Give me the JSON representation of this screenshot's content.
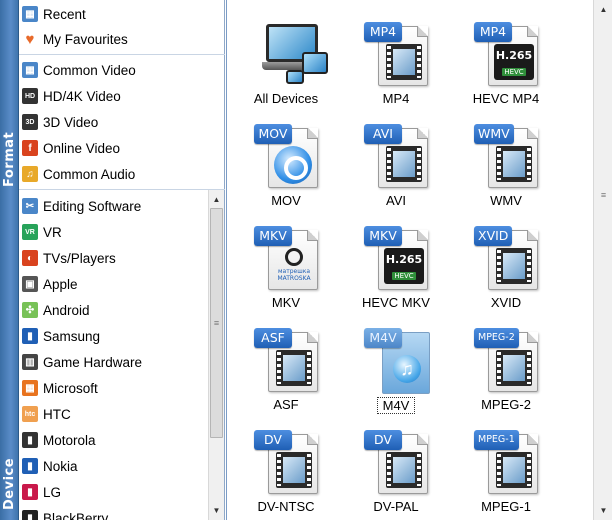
{
  "tabs": {
    "format_label": "Format",
    "device_label": "Device"
  },
  "format_list": [
    {
      "label": "Recent",
      "icon": "recent-icon",
      "color": "#4a86c8"
    },
    {
      "label": "My Favourites",
      "icon": "heart-icon",
      "color": "#e86a2a"
    },
    {
      "label": "Common Video",
      "icon": "film-icon",
      "color": "#4a86c8"
    },
    {
      "label": "HD/4K Video",
      "icon": "hd-icon",
      "color": "#333333"
    },
    {
      "label": "3D Video",
      "icon": "3d-icon",
      "color": "#333333"
    },
    {
      "label": "Online Video",
      "icon": "online-video-icon",
      "color": "#d9431e"
    },
    {
      "label": "Common Audio",
      "icon": "music-note-icon",
      "color": "#e8a92a"
    }
  ],
  "device_list": [
    {
      "label": "Editing Software",
      "icon": "editing-software-icon",
      "color": "#4a86c8"
    },
    {
      "label": "VR",
      "icon": "vr-icon",
      "color": "#27a35a"
    },
    {
      "label": "TVs/Players",
      "icon": "tv-icon",
      "color": "#d9431e"
    },
    {
      "label": "Apple",
      "icon": "apple-icon",
      "color": "#555555"
    },
    {
      "label": "Android",
      "icon": "android-icon",
      "color": "#78c257"
    },
    {
      "label": "Samsung",
      "icon": "samsung-icon",
      "color": "#1f5fb5"
    },
    {
      "label": "Game Hardware",
      "icon": "game-hardware-icon",
      "color": "#444444"
    },
    {
      "label": "Microsoft",
      "icon": "microsoft-icon",
      "color": "#e8731e"
    },
    {
      "label": "HTC",
      "icon": "htc-icon",
      "color": "#f0a050"
    },
    {
      "label": "Motorola",
      "icon": "motorola-icon",
      "color": "#333333"
    },
    {
      "label": "Nokia",
      "icon": "nokia-icon",
      "color": "#1f5fb5"
    },
    {
      "label": "LG",
      "icon": "lg-icon",
      "color": "#c9184a"
    },
    {
      "label": "BlackBerry",
      "icon": "blackberry-icon",
      "color": "#222222"
    }
  ],
  "formats": [
    {
      "name": "All Devices",
      "badge": "",
      "kind": "devices"
    },
    {
      "name": "MP4",
      "badge": "MP4",
      "kind": "film"
    },
    {
      "name": "HEVC MP4",
      "badge": "MP4",
      "kind": "hevc"
    },
    {
      "name": "MOV",
      "badge": "MOV",
      "kind": "quicktime"
    },
    {
      "name": "AVI",
      "badge": "AVI",
      "kind": "film"
    },
    {
      "name": "WMV",
      "badge": "WMV",
      "kind": "film"
    },
    {
      "name": "MKV",
      "badge": "MKV",
      "kind": "matroska"
    },
    {
      "name": "HEVC MKV",
      "badge": "MKV",
      "kind": "hevc"
    },
    {
      "name": "XVID",
      "badge": "XVID",
      "kind": "film"
    },
    {
      "name": "ASF",
      "badge": "ASF",
      "kind": "film"
    },
    {
      "name": "M4V",
      "badge": "M4V",
      "kind": "m4v",
      "selected": true
    },
    {
      "name": "MPEG-2",
      "badge": "MPEG-2",
      "kind": "film"
    },
    {
      "name": "DV-NTSC",
      "badge": "DV",
      "kind": "film"
    },
    {
      "name": "DV-PAL",
      "badge": "DV",
      "kind": "film"
    },
    {
      "name": "MPEG-1",
      "badge": "MPEG-1",
      "kind": "film"
    }
  ],
  "hevc_text": {
    "line1": "H.265",
    "line2": "HEVC"
  },
  "matroska_text": "матрешка MATROSKA",
  "colors": {
    "accent": "#1f5fb5",
    "tab_bg": "#4a7fb8",
    "badge_bg": "#2f6fc4"
  }
}
